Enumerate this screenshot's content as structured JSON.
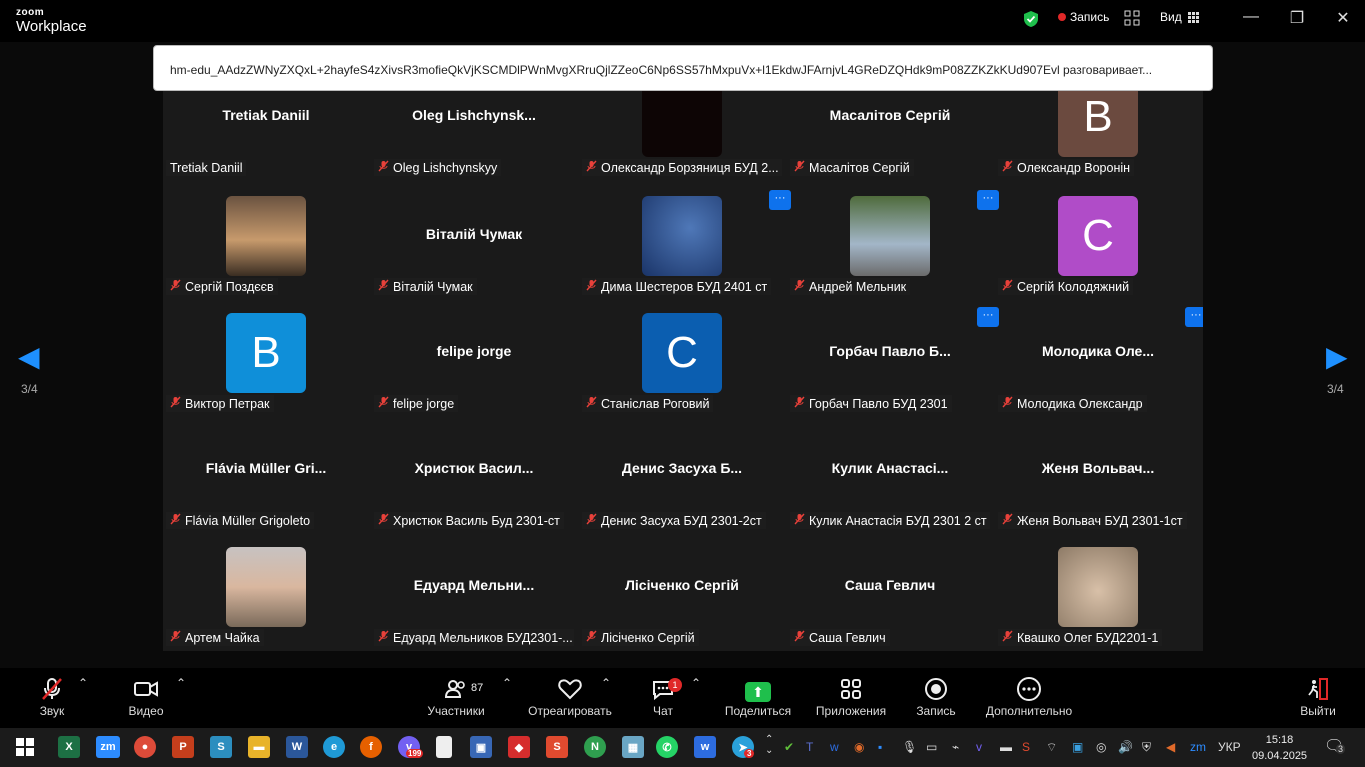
{
  "app": {
    "logo_small": "zoom",
    "logo_big": "Workplace"
  },
  "topbar": {
    "record_label": "Запись",
    "view_label": "Вид"
  },
  "url_text": "hm-edu_AAdzZWNyZXQxL+2hayfeS4zXivsR3mofieQkVjKSCMDlPWnMvgXRruQjlZZeoC6Np6SS57hMxpuVx+l1EkdwJFArnjvL4GReDZQHdk9mP08ZZKZkKUd907Evl разговаривает...",
  "page_indicator": "3/4",
  "participants": [
    {
      "display": "Tretiak Daniil",
      "name": "Tretiak Daniil",
      "muted": false
    },
    {
      "display": "Oleg  Lishchynsk...",
      "name": "Oleg Lishchynskyy",
      "muted": true
    },
    {
      "display": "",
      "name": "Олександр Борзяниця БУД 2...",
      "muted": true,
      "photo": "dark"
    },
    {
      "display": "Масалітов Сергій",
      "name": "Масалітов Сергій",
      "muted": true
    },
    {
      "display": "",
      "name": "Олександр Воронін",
      "muted": true,
      "avatar": "B",
      "avatar_color": "#6b4a3f"
    },
    {
      "display": "",
      "name": "Сергій Поздєєв",
      "muted": true,
      "photo": "sunset"
    },
    {
      "display": "Віталій Чумак",
      "name": "Віталій Чумак",
      "muted": true
    },
    {
      "display": "",
      "name": "Дима Шестеров БУД 2401 ст",
      "muted": true,
      "photo": "stars",
      "more": true
    },
    {
      "display": "",
      "name": "Андрей Мельник",
      "muted": true,
      "photo": "boy",
      "more": true
    },
    {
      "display": "",
      "name": "Сергій Колодяжний",
      "muted": true,
      "avatar": "C",
      "avatar_color": "#b04cc8"
    },
    {
      "display": "",
      "name": "Виктор Петрак",
      "muted": true,
      "avatar": "B",
      "avatar_color": "#0f8fd9"
    },
    {
      "display": "felipe jorge",
      "name": "felipe jorge",
      "muted": true
    },
    {
      "display": "",
      "name": "Станіслав Роговий",
      "muted": true,
      "avatar": "C",
      "avatar_color": "#0b5eb0"
    },
    {
      "display": "Горбач  Павло  Б...",
      "name": "Горбач Павло БУД 2301",
      "muted": true,
      "more": true
    },
    {
      "display": "Молодика  Оле...",
      "name": "Молодика Олександр",
      "muted": true,
      "more": true
    },
    {
      "display": "Flávia  Müller  Gri...",
      "name": "Flávia Müller Grigoleto",
      "muted": true
    },
    {
      "display": "Христюк  Васил...",
      "name": "Христюк Василь Буд 2301-ст",
      "muted": true
    },
    {
      "display": "Денис  Засуха  Б...",
      "name": "Денис Засуха БУД 2301-2ст",
      "muted": true
    },
    {
      "display": "Кулик  Анастасі...",
      "name": "Кулик Анастасія БУД 2301 2 ст",
      "muted": true
    },
    {
      "display": "Женя  Вольвач...",
      "name": "Женя Вольвач БУД 2301-1ст",
      "muted": true
    },
    {
      "display": "",
      "name": "Артем Чайка",
      "muted": true,
      "photo": "teen"
    },
    {
      "display": "Едуард  Мельни...",
      "name": "Едуард Мельников БУД2301-...",
      "muted": true
    },
    {
      "display": "Лісіченко Сергій",
      "name": "Лісіченко Сергій",
      "muted": true
    },
    {
      "display": "Саша Гевлич",
      "name": "Саша Гевлич",
      "muted": true
    },
    {
      "display": "",
      "name": "Квашко Олег БУД2201-1",
      "muted": true,
      "photo": "cat"
    }
  ],
  "controls": {
    "audio": "Звук",
    "video": "Видео",
    "participants": "Участники",
    "participants_count": "87",
    "react": "Отреагировать",
    "chat": "Чат",
    "chat_badge": "1",
    "share": "Поделиться",
    "apps": "Приложения",
    "record": "Запись",
    "more": "Дополнительно",
    "leave": "Выйти"
  },
  "taskbar": {
    "viber_badge": "199",
    "telegram_badge": "3",
    "lang": "УКР",
    "time": "15:18",
    "date": "09.04.2025",
    "notif_count": "3"
  }
}
